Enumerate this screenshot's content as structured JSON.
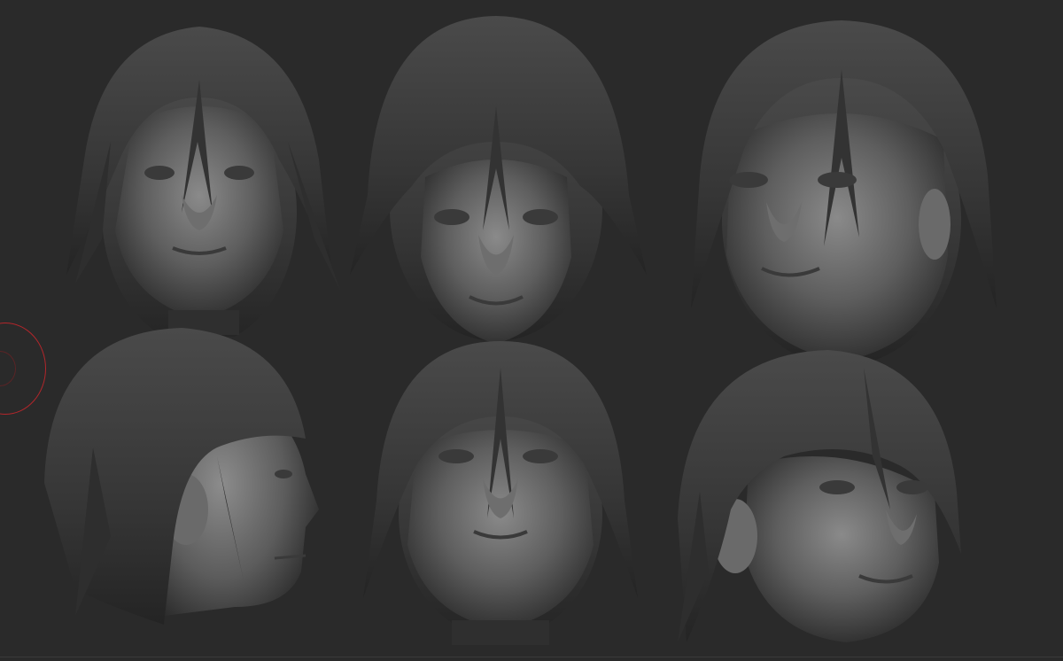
{
  "viewport": {
    "background_color": "#2a2a2a",
    "clay_color": "#5a5a5a",
    "hair_color": "#3c3c3c",
    "brush_cursor_color": "#b3262b"
  },
  "models": [
    {
      "view": "front"
    },
    {
      "view": "front-low-angle"
    },
    {
      "view": "front-three-quarter"
    },
    {
      "view": "right-profile"
    },
    {
      "view": "front-high-angle"
    },
    {
      "view": "three-quarter-left"
    }
  ]
}
